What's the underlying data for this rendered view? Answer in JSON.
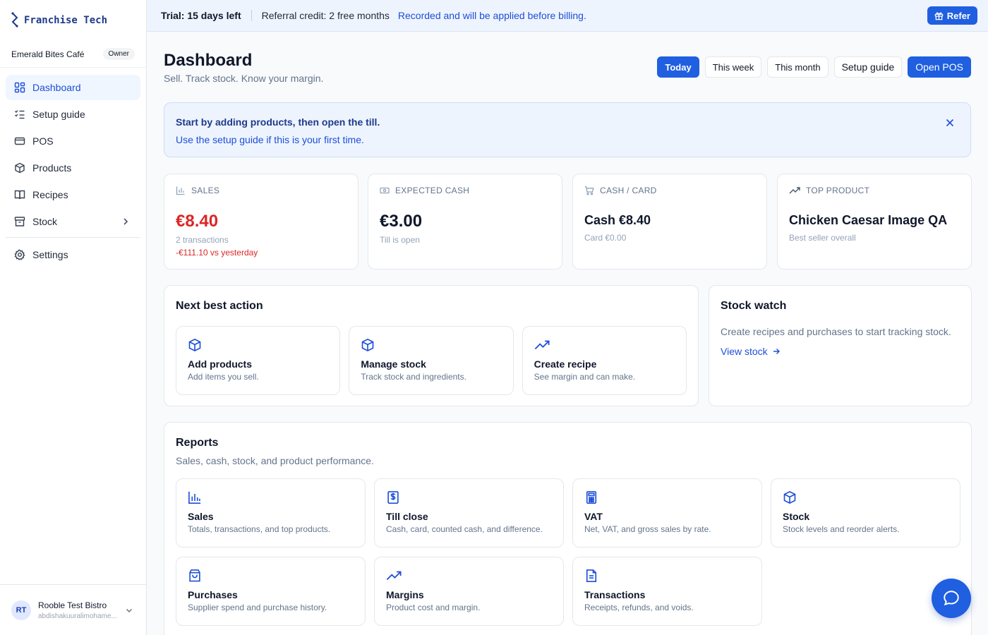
{
  "brand": {
    "name": "Franchise Tech"
  },
  "org": {
    "name": "Emerald Bites Café",
    "role": "Owner"
  },
  "sidebar": {
    "items": [
      {
        "label": "Dashboard"
      },
      {
        "label": "Setup guide"
      },
      {
        "label": "POS"
      },
      {
        "label": "Products"
      },
      {
        "label": "Recipes"
      },
      {
        "label": "Stock"
      },
      {
        "label": "Settings"
      }
    ]
  },
  "user": {
    "initials": "RT",
    "name": "Rooble Test Bistro",
    "email": "abdishakuuralimohame..."
  },
  "topbar": {
    "trial": "Trial: 15 days left",
    "referral": "Referral credit: 2 free months",
    "recorded": "Recorded and will be applied before billing.",
    "refer_label": "Refer"
  },
  "header": {
    "title": "Dashboard",
    "subtitle": "Sell. Track stock. Know your margin.",
    "periods": [
      "Today",
      "This week",
      "This month"
    ],
    "setup_label": "Setup guide",
    "pos_label": "Open POS"
  },
  "info": {
    "line1": "Start by adding products, then open the till.",
    "line2": "Use the setup guide if this is your first time."
  },
  "kpis": {
    "sales": {
      "label": "SALES",
      "value": "€8.40",
      "sub": "2 transactions",
      "delta": "-€111.10 vs yesterday"
    },
    "expected_cash": {
      "label": "EXPECTED CASH",
      "value": "€3.00",
      "sub": "Till is open"
    },
    "cash_card": {
      "label": "CASH / CARD",
      "value": "Cash €8.40",
      "sub": "Card €0.00"
    },
    "top_product": {
      "label": "TOP PRODUCT",
      "value": "Chicken Caesar Image QA",
      "sub": "Best seller overall"
    }
  },
  "next_action": {
    "title": "Next best action",
    "cards": [
      {
        "title": "Add products",
        "desc": "Add items you sell.",
        "icon": "box-icon"
      },
      {
        "title": "Manage stock",
        "desc": "Track stock and ingredients.",
        "icon": "box-icon"
      },
      {
        "title": "Create recipe",
        "desc": "See margin and can make.",
        "icon": "trending-up-icon"
      }
    ]
  },
  "stock_watch": {
    "title": "Stock watch",
    "text": "Create recipes and purchases to start tracking stock.",
    "link": "View stock"
  },
  "reports": {
    "title": "Reports",
    "subtitle": "Sales, cash, stock, and product performance.",
    "cards": [
      {
        "title": "Sales",
        "desc": "Totals, transactions, and top products.",
        "icon": "bar-chart-icon"
      },
      {
        "title": "Till close",
        "desc": "Cash, card, counted cash, and difference.",
        "icon": "receipt-dollar-icon"
      },
      {
        "title": "VAT",
        "desc": "Net, VAT, and gross sales by rate.",
        "icon": "calculator-icon"
      },
      {
        "title": "Stock",
        "desc": "Stock levels and reorder alerts.",
        "icon": "box-icon"
      },
      {
        "title": "Purchases",
        "desc": "Supplier spend and purchase history.",
        "icon": "shopping-bag-icon"
      },
      {
        "title": "Margins",
        "desc": "Product cost and margin.",
        "icon": "trending-up-icon"
      },
      {
        "title": "Transactions",
        "desc": "Receipts, refunds, and voids.",
        "icon": "document-icon"
      }
    ]
  },
  "colors": {
    "accent": "#1f5fe0",
    "danger": "#dc2626",
    "banner_bg": "#eef4fe"
  }
}
